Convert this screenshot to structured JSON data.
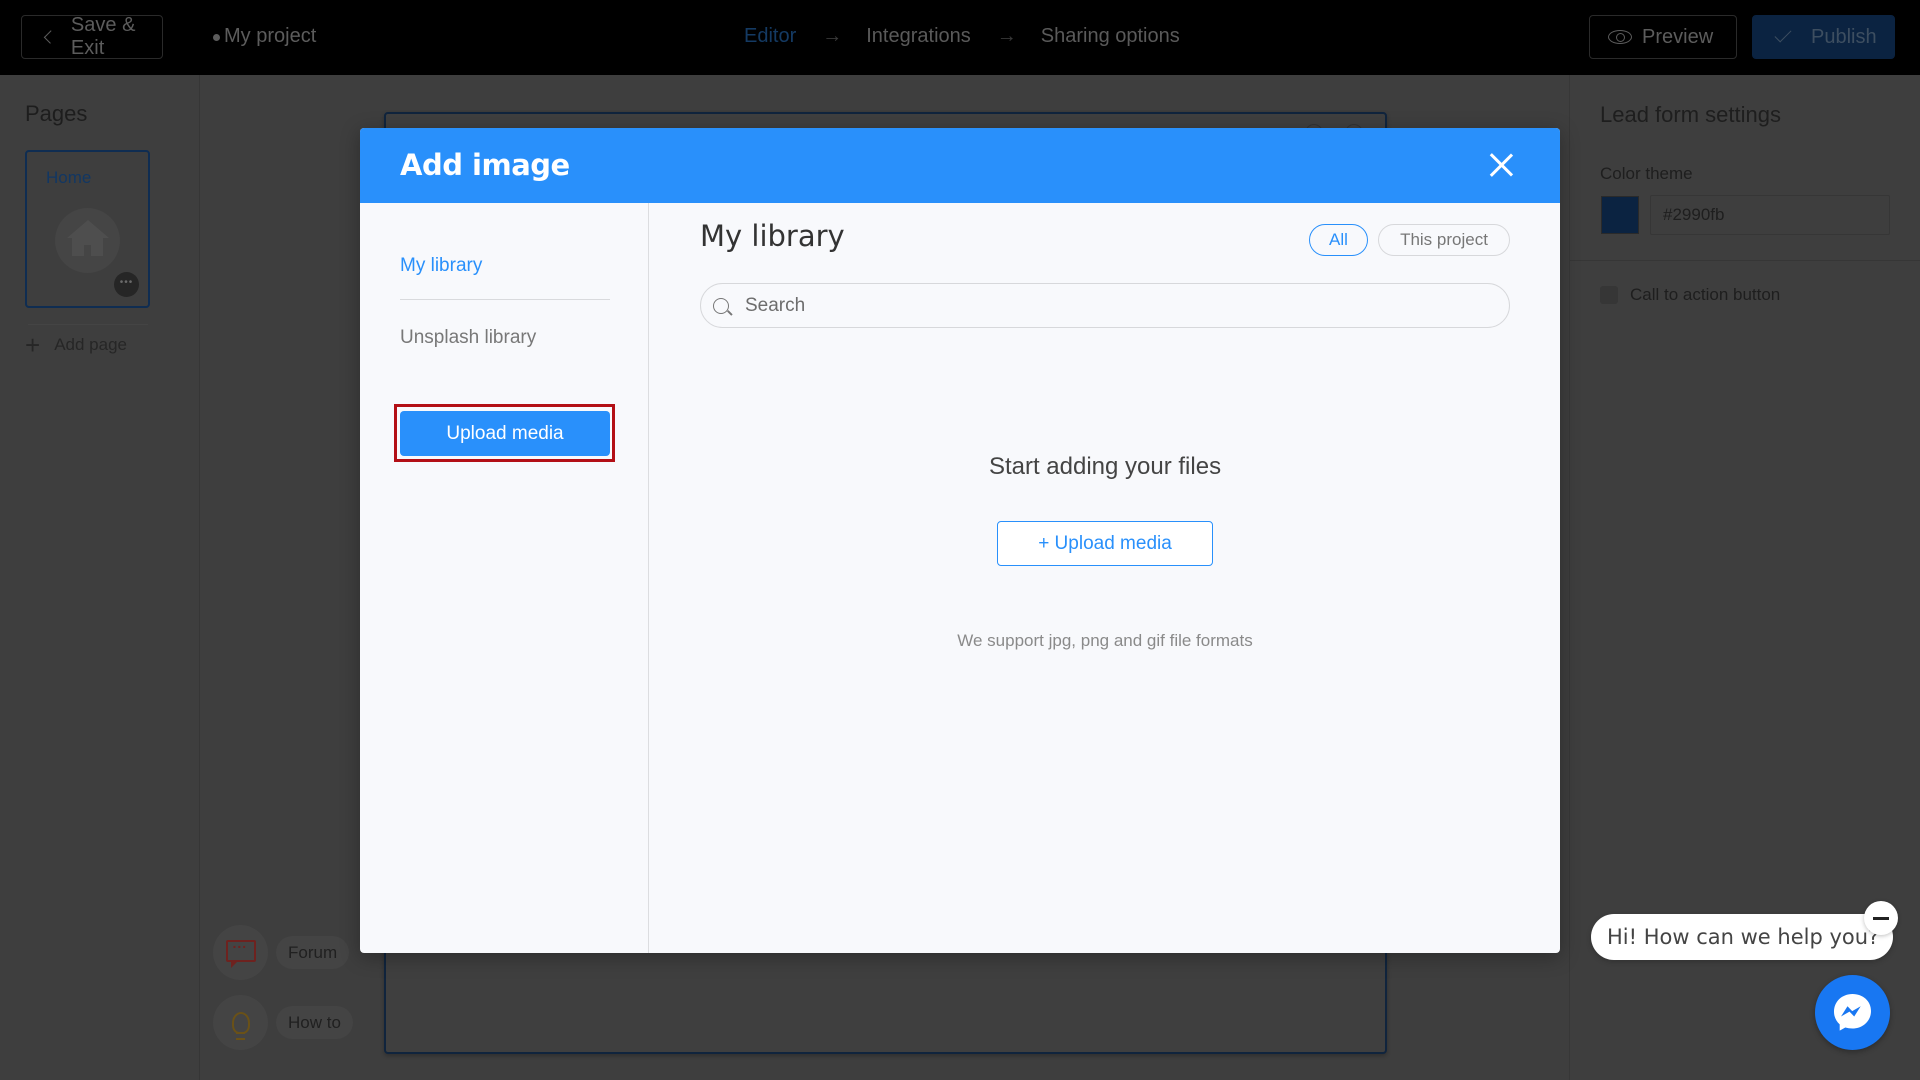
{
  "topbar": {
    "save_exit_label": "Save & Exit",
    "project_name": "My project",
    "steps": [
      {
        "label": "Editor",
        "active": true
      },
      {
        "label": "Integrations",
        "active": false
      },
      {
        "label": "Sharing options",
        "active": false
      }
    ],
    "arrow_glyph": "→",
    "preview_label": "Preview",
    "publish_label": "Publish"
  },
  "pages_sidebar": {
    "title": "Pages",
    "pages": [
      {
        "label": "Home",
        "more_glyph": "•••"
      }
    ],
    "add_page_label": "Add page"
  },
  "help": {
    "forum_label": "Forum",
    "howto_label": "How to"
  },
  "settings": {
    "title": "Lead form settings",
    "color_theme_label": "Color theme",
    "color_value": "#2990fb",
    "cta_label": "Call to action button",
    "cta_checked": false
  },
  "modal": {
    "title": "Add image",
    "nav": {
      "my_library": "My library",
      "unsplash_library": "Unsplash library",
      "upload_media": "Upload media"
    },
    "content": {
      "heading": "My library",
      "filters": [
        {
          "label": "All",
          "selected": true
        },
        {
          "label": "This project",
          "selected": false
        }
      ],
      "search_placeholder": "Search",
      "search_value": "",
      "empty_title": "Start adding your files",
      "upload_button": "+ Upload media",
      "support_text": "We support jpg, png and gif file formats"
    },
    "accent_color": "#2990fb",
    "highlight_color": "#b30f16"
  },
  "chat": {
    "greeting": "Hi! How can we help you?",
    "brand_color": "#1877f2"
  }
}
